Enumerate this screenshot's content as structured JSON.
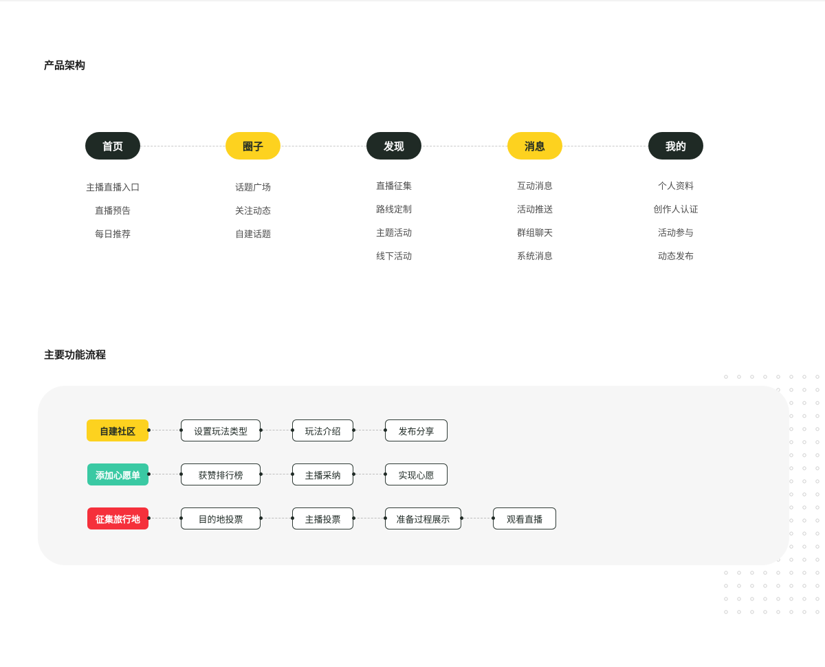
{
  "architecture": {
    "title": "产品架构",
    "columns": [
      {
        "label": "首页",
        "style": "dark",
        "items": [
          "主播直播入口",
          "直播预告",
          "每日推荐"
        ]
      },
      {
        "label": "圈子",
        "style": "yellow",
        "items": [
          "话题广场",
          "关注动态",
          "自建话题"
        ]
      },
      {
        "label": "发现",
        "style": "dark",
        "items": [
          "直播征集",
          "路线定制",
          "主题活动",
          "线下活动"
        ]
      },
      {
        "label": "消息",
        "style": "yellow",
        "items": [
          "互动消息",
          "活动推送",
          "群组聊天",
          "系统消息"
        ]
      },
      {
        "label": "我的",
        "style": "dark",
        "items": [
          "个人资料",
          "创作人认证",
          "活动参与",
          "动态发布"
        ]
      }
    ]
  },
  "flow": {
    "title": "主要功能流程",
    "rows": [
      {
        "start": "自建社区",
        "color": "yellow",
        "steps": [
          "设置玩法类型",
          "玩法介绍",
          "发布分享"
        ]
      },
      {
        "start": "添加心愿单",
        "color": "green",
        "steps": [
          "获赞排行榜",
          "主播采纳",
          "实现心愿"
        ]
      },
      {
        "start": "征集旅行地",
        "color": "red",
        "steps": [
          "目的地投票",
          "主播投票",
          "准备过程展示",
          "观看直播"
        ]
      }
    ]
  },
  "colors": {
    "dark": "#1f2a25",
    "yellow": "#fdd21f",
    "green": "#3ac9a3",
    "red": "#f5303b",
    "panel": "#f6f6f6"
  }
}
